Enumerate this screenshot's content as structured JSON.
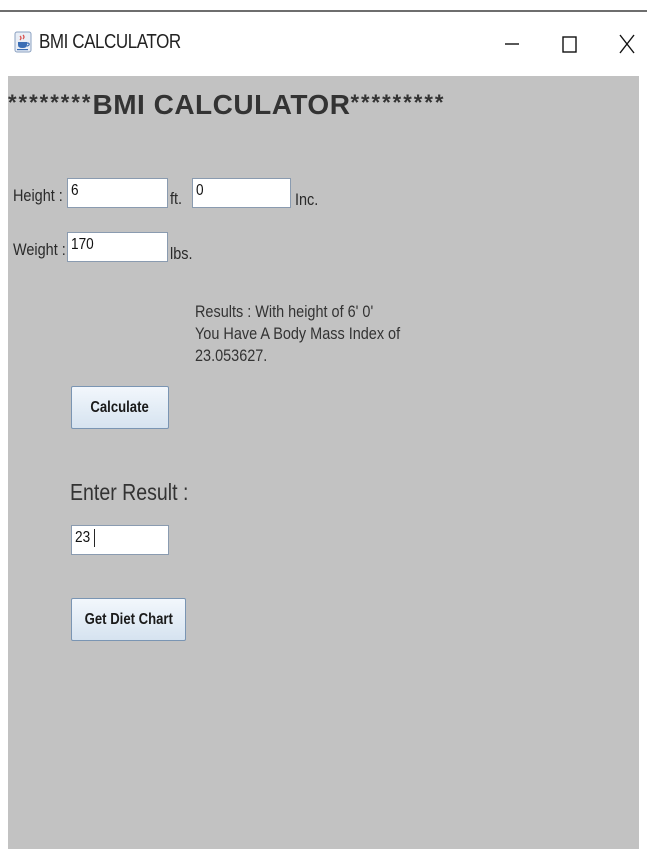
{
  "window": {
    "title": "BMI CALCULATOR",
    "icon": "java-cup-icon",
    "controls": [
      "minimize-icon",
      "maximize-icon",
      "close-icon"
    ]
  },
  "heading": {
    "prefix": "********",
    "text": "BMI CALCULATOR",
    "suffix": "*********"
  },
  "form": {
    "height_label": "Height :",
    "height_feet_value": "6",
    "feet_unit": "ft.",
    "height_inches_value": "0",
    "inches_unit": "Inc.",
    "weight_label": "Weight :",
    "weight_value": "170",
    "weight_unit": "lbs."
  },
  "results": {
    "line1": "Results : With height of 6' 0'",
    "line2": "You Have A Body Mass Index of",
    "line3": "23.053627."
  },
  "buttons": {
    "calculate": "Calculate",
    "diet_chart": "Get Diet Chart"
  },
  "enter_result": {
    "label": "Enter Result :",
    "value": "23"
  },
  "colors": {
    "panel_background": "#c2c2c2",
    "button_border": "#7a95b3",
    "field_border": "#8a9bb0"
  }
}
